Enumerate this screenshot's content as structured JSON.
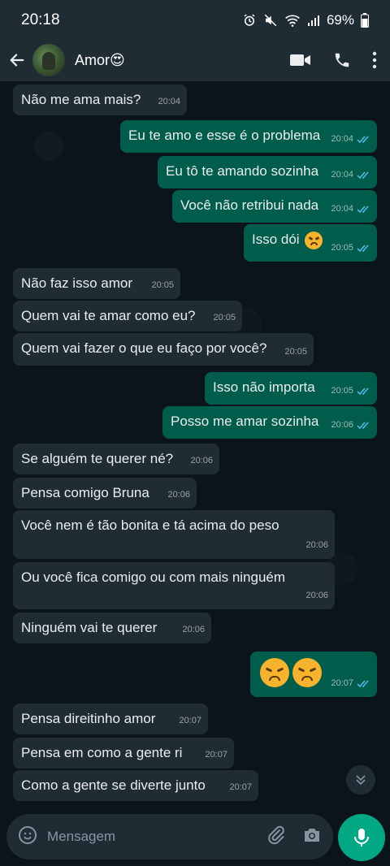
{
  "status": {
    "time": "20:18",
    "battery": "69%"
  },
  "header": {
    "contact": "Amor😍"
  },
  "composer": {
    "placeholder": "Mensagem"
  },
  "messages": [
    {
      "dir": "in",
      "text": "Não me ama mais?",
      "time": "20:04"
    },
    {
      "dir": "out",
      "text": "Eu te amo e esse é o problema",
      "time": "20:04"
    },
    {
      "dir": "out",
      "text": "Eu tô te amando sozinha",
      "time": "20:04"
    },
    {
      "dir": "out",
      "text": "Você não retribui nada",
      "time": "20:04"
    },
    {
      "dir": "out",
      "text": "Isso dói",
      "time": "20:05"
    },
    {
      "dir": "in",
      "text": "Não faz isso amor",
      "time": "20:05"
    },
    {
      "dir": "in",
      "text": "Quem vai te amar como eu?",
      "time": "20:05"
    },
    {
      "dir": "in",
      "text": "Quem vai fazer o que eu faço por você?",
      "time": "20:05"
    },
    {
      "dir": "out",
      "text": "Isso não importa",
      "time": "20:05"
    },
    {
      "dir": "out",
      "text": "Posso me amar sozinha",
      "time": "20:06"
    },
    {
      "dir": "in",
      "text": "Se alguém te querer né?",
      "time": "20:06"
    },
    {
      "dir": "in",
      "text": "Pensa comigo Bruna",
      "time": "20:06"
    },
    {
      "dir": "in",
      "text": "Você nem é tão bonita e tá acima do peso",
      "time": "20:06"
    },
    {
      "dir": "in",
      "text": "Ou você fica comigo ou com mais ninguém",
      "time": "20:06"
    },
    {
      "dir": "in",
      "text": "Ninguém vai te querer",
      "time": "20:06"
    },
    {
      "dir": "out",
      "text": "",
      "time": "20:07"
    },
    {
      "dir": "in",
      "text": "Pensa direitinho amor",
      "time": "20:07"
    },
    {
      "dir": "in",
      "text": "Pensa em como a gente ri",
      "time": "20:07"
    },
    {
      "dir": "in",
      "text": "Como a gente se diverte junto",
      "time": "20:07"
    }
  ]
}
